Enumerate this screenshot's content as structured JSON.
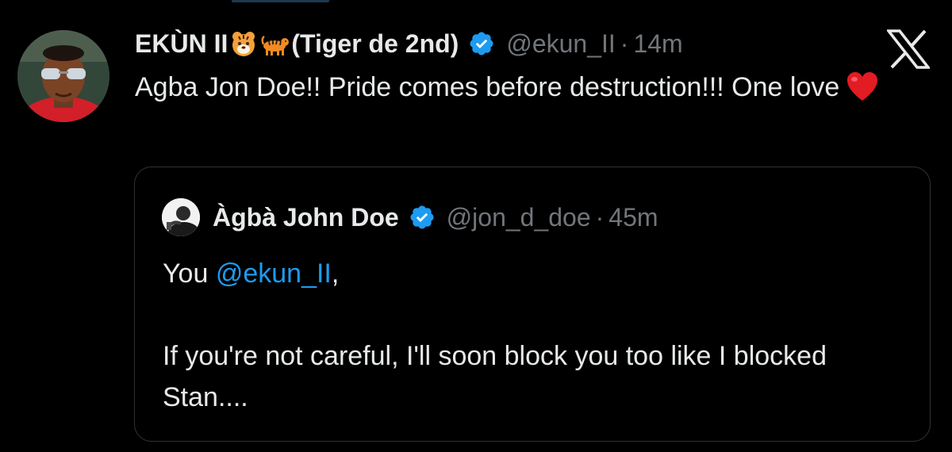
{
  "tweet": {
    "display_name": "EKÙN II",
    "display_name_suffix": "(Tiger de 2nd)",
    "handle": "@ekun_II",
    "separator": "·",
    "time": "14m",
    "text": "Agba Jon Doe!! Pride comes before destruction!!! One love",
    "emojis": [
      "tiger-face-icon",
      "tiger-icon",
      "red-heart-icon"
    ]
  },
  "quoted_tweet": {
    "display_name": "Àgbà John Doe",
    "handle": "@jon_d_doe",
    "separator": "·",
    "time": "45m",
    "line1_prefix": "You ",
    "line1_mention": "@ekun_II",
    "line1_suffix": ",",
    "line2": "If you're not careful, I'll soon block you too like I blocked Stan...."
  },
  "colors": {
    "background": "#000000",
    "text": "#e7e9ea",
    "muted": "#71767b",
    "accent": "#1d9bf0",
    "border": "#2f3336"
  }
}
